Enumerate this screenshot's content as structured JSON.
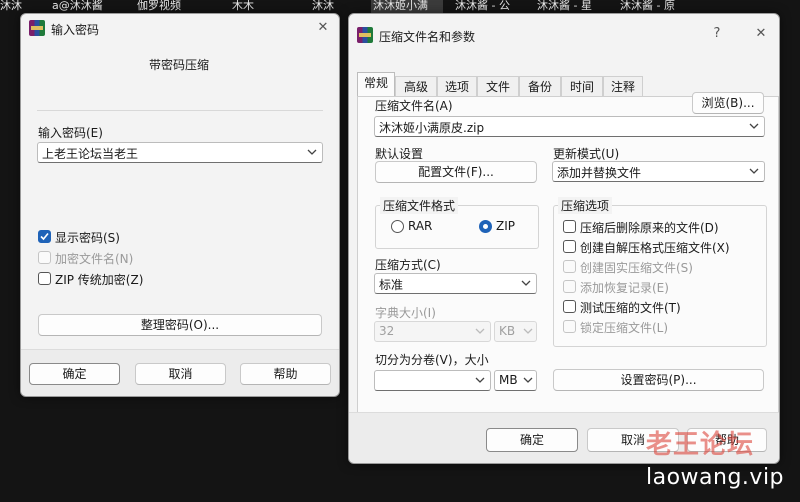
{
  "taskbar": [
    "沐沐",
    "a@沐沐酱",
    "伽罗视频",
    "木木",
    "沐沐",
    "沐沐姬小满",
    "沐沐酱 - 公",
    "沐沐酱 - 星",
    "沐沐酱 - 原"
  ],
  "password_dialog": {
    "title": "输入密码",
    "close_glyph": "✕",
    "heading": "带密码压缩",
    "password_label": "输入密码(E)",
    "password_value": "上老王论坛当老王",
    "show_password": {
      "label": "显示密码(S)",
      "checked": true
    },
    "encrypt_filenames": {
      "label": "加密文件名(N)",
      "checked": false,
      "disabled": true
    },
    "zip_legacy": {
      "label": "ZIP 传统加密(Z)",
      "checked": false
    },
    "organize_button": "整理密码(O)...",
    "ok_button": "确定",
    "cancel_button": "取消",
    "help_button": "帮助"
  },
  "archive_dialog": {
    "title": "压缩文件名和参数",
    "help_glyph": "?",
    "close_glyph": "✕",
    "tabs": [
      "常规",
      "高级",
      "选项",
      "文件",
      "备份",
      "时间",
      "注释"
    ],
    "archive_name_label": "压缩文件名(A)",
    "browse_button": "浏览(B)...",
    "archive_name_value": "沐沐姬小满原皮.zip",
    "default_settings_label": "默认设置",
    "profiles_button": "配置文件(F)...",
    "update_mode_label": "更新模式(U)",
    "update_mode_value": "添加并替换文件",
    "format_group": "压缩文件格式",
    "format_rar": "RAR",
    "format_zip": "ZIP",
    "format_selected": "ZIP",
    "method_label": "压缩方式(C)",
    "method_value": "标准",
    "dict_label": "字典大小(I)",
    "dict_value": "32",
    "dict_unit": "KB",
    "split_label": "切分为分卷(V)，大小",
    "split_value": "",
    "split_unit": "MB",
    "options_group": "压缩选项",
    "options": [
      {
        "label": "压缩后删除原来的文件(D)",
        "checked": false,
        "disabled": false
      },
      {
        "label": "创建自解压格式压缩文件(X)",
        "checked": false,
        "disabled": false
      },
      {
        "label": "创建固实压缩文件(S)",
        "checked": false,
        "disabled": true
      },
      {
        "label": "添加恢复记录(E)",
        "checked": false,
        "disabled": true
      },
      {
        "label": "测试压缩的文件(T)",
        "checked": false,
        "disabled": false
      },
      {
        "label": "锁定压缩文件(L)",
        "checked": false,
        "disabled": true
      }
    ],
    "set_password_button": "设置密码(P)...",
    "ok_button": "确定",
    "cancel_button": "取消",
    "help_button": "帮助"
  },
  "watermark": {
    "cn": "老王论坛",
    "en": "laowang.vip"
  }
}
